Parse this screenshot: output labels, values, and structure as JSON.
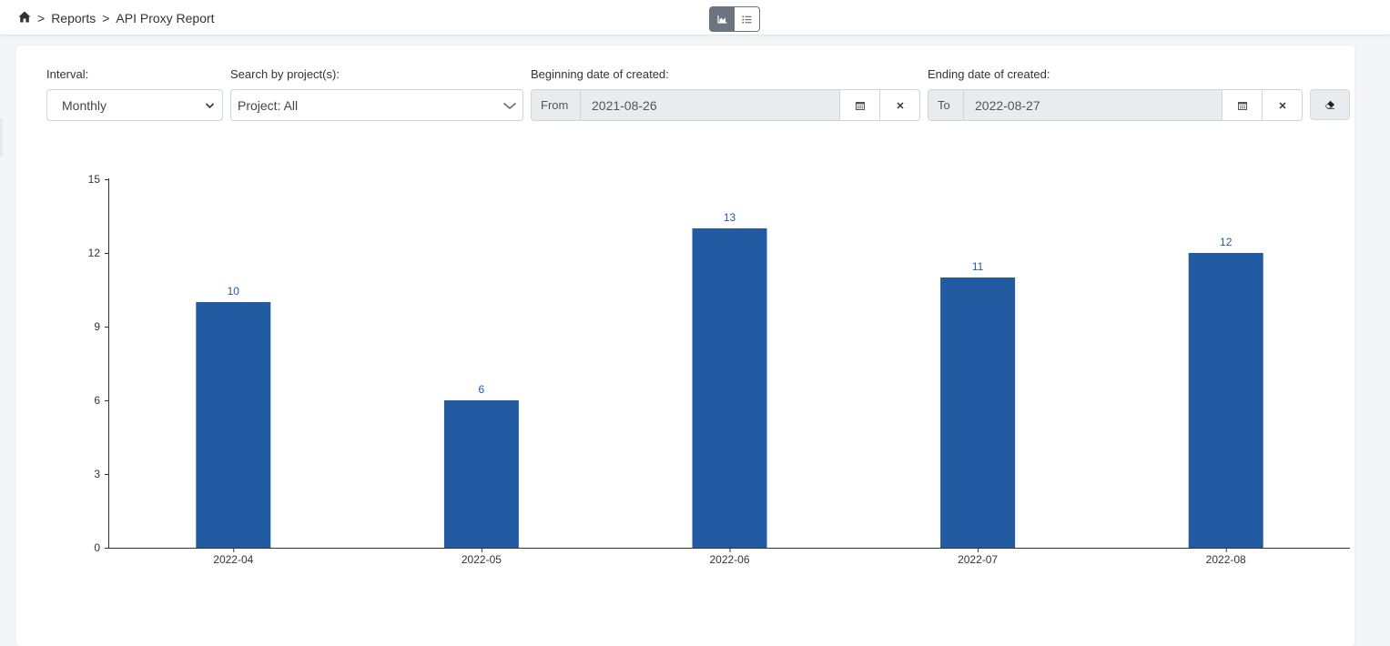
{
  "breadcrumb": {
    "separator": ">",
    "items": [
      "Reports",
      "API Proxy Report"
    ]
  },
  "view_toggle": {
    "active": "chart-view",
    "icons": [
      "area-chart-icon",
      "list-icon"
    ]
  },
  "filters": {
    "interval": {
      "label": "Interval:",
      "value": "Monthly"
    },
    "project": {
      "label": "Search by project(s):",
      "value": "Project: All"
    },
    "begin_date": {
      "label": "Beginning date of created:",
      "prefix": "From",
      "value": "2021-08-26"
    },
    "end_date": {
      "label": "Ending date of created:",
      "prefix": "To",
      "value": "2022-08-27"
    }
  },
  "colors": {
    "bar": "#235ba3",
    "data_label": "#235ba3",
    "toggle_active": "#6c757d"
  },
  "chart_data": {
    "type": "bar",
    "categories": [
      "2022-04",
      "2022-05",
      "2022-06",
      "2022-07",
      "2022-08"
    ],
    "values": [
      10,
      6,
      13,
      11,
      12
    ],
    "title": "",
    "xlabel": "",
    "ylabel": "",
    "ylim": [
      0,
      15
    ],
    "yticks": [
      0,
      3,
      6,
      9,
      12,
      15
    ],
    "grid": false,
    "data_labels": true
  }
}
